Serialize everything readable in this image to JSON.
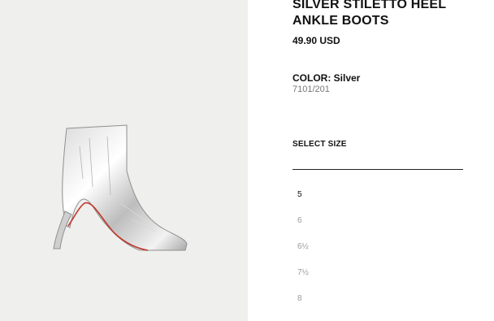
{
  "product": {
    "title": "SILVER STILETTO HEEL ANKLE BOOTS",
    "price": "49.90 USD",
    "color": "COLOR: Silver",
    "sku": "7101/201"
  },
  "size_selector": {
    "label": "SELECT SIZE",
    "sizes": [
      "5",
      "6",
      "6½",
      "7½",
      "8"
    ]
  },
  "image": {
    "subject": "silver-ankle-boot",
    "background_color": "#efefed"
  }
}
